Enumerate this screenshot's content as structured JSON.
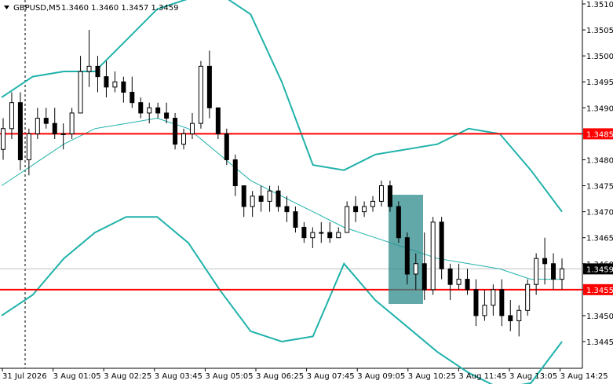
{
  "chart_data": {
    "type": "candlestick",
    "header": {
      "symbol_tf": "GBPUSD,M5",
      "ohlc": "1.3460 1.3460 1.3457 1.3459"
    },
    "y_range": [
      1.344,
      1.351
    ],
    "y_ticks": [
      "1.3510",
      "1.3505",
      "1.3500",
      "1.3495",
      "1.3490",
      "1.3485",
      "1.3480",
      "1.3475",
      "1.3470",
      "1.3465",
      "1.3460",
      "1.3455",
      "1.3450",
      "1.3445"
    ],
    "x_ticks": [
      "31 Jul 2026",
      "3 Aug 01:05",
      "3 Aug 02:25",
      "3 Aug 03:45",
      "3 Aug 05:05",
      "3 Aug 06:25",
      "3 Aug 07:45",
      "3 Aug 09:05",
      "3 Aug 10:25",
      "3 Aug 11:45",
      "3 Aug 13:05",
      "3 Aug 14:25"
    ],
    "grid": false,
    "levels": [
      {
        "value": 1.3485,
        "label": "1.3485",
        "color": "#ff0000"
      },
      {
        "value": 1.3455,
        "label": "1.3455",
        "color": "#ff0000"
      }
    ],
    "current_price": {
      "value": 1.3459,
      "label": "1.3459"
    },
    "colors": {
      "bands": "#20b2aa",
      "highlight_box": "#2e8b8b",
      "level_line": "#ff0000",
      "candle": "#000000"
    },
    "bollinger": {
      "upper": [
        1.3492,
        1.3496,
        1.3497,
        1.3497,
        1.3503,
        1.3509,
        1.3511,
        1.3512,
        1.3508,
        1.3495,
        1.3479,
        1.3478,
        1.3481,
        1.3482,
        1.3483,
        1.3486,
        1.3485,
        1.3478,
        1.347
      ],
      "middle": [
        1.3475,
        1.3479,
        1.3483,
        1.3486,
        1.3487,
        1.3488,
        1.3486,
        1.3481,
        1.3476,
        1.3473,
        1.347,
        1.3467,
        1.3465,
        1.3463,
        1.3461,
        1.346,
        1.3459,
        1.3457,
        1.3457
      ],
      "lower": [
        1.345,
        1.3454,
        1.3461,
        1.3466,
        1.3469,
        1.3469,
        1.3464,
        1.3455,
        1.3447,
        1.3445,
        1.3446,
        1.346,
        1.3453,
        1.3448,
        1.3443,
        1.3439,
        1.3436,
        1.3437,
        1.3445
      ]
    },
    "candles": [
      [
        1.3482,
        1.3488,
        1.348,
        1.3486
      ],
      [
        1.3486,
        1.3493,
        1.3484,
        1.3491
      ],
      [
        1.3491,
        1.3493,
        1.3478,
        1.348
      ],
      [
        1.348,
        1.3486,
        1.3477,
        1.3485
      ],
      [
        1.3485,
        1.349,
        1.3484,
        1.3488
      ],
      [
        1.3488,
        1.349,
        1.3486,
        1.3487
      ],
      [
        1.3487,
        1.349,
        1.3484,
        1.3485
      ],
      [
        1.3485,
        1.3487,
        1.3482,
        1.3485
      ],
      [
        1.3485,
        1.349,
        1.3484,
        1.3489
      ],
      [
        1.3489,
        1.35,
        1.3489,
        1.3497
      ],
      [
        1.3497,
        1.3505,
        1.3494,
        1.3498
      ],
      [
        1.3498,
        1.35,
        1.3493,
        1.3496
      ],
      [
        1.3496,
        1.3499,
        1.3492,
        1.3494
      ],
      [
        1.3494,
        1.3497,
        1.3493,
        1.3495
      ],
      [
        1.3495,
        1.3496,
        1.3491,
        1.3493
      ],
      [
        1.3493,
        1.3496,
        1.349,
        1.3491
      ],
      [
        1.3491,
        1.3492,
        1.3488,
        1.3489
      ],
      [
        1.3489,
        1.3491,
        1.3487,
        1.349
      ],
      [
        1.349,
        1.3491,
        1.3488,
        1.3489
      ],
      [
        1.3489,
        1.3491,
        1.3487,
        1.3488
      ],
      [
        1.3488,
        1.3489,
        1.3482,
        1.3483
      ],
      [
        1.3483,
        1.3486,
        1.3482,
        1.3485
      ],
      [
        1.3485,
        1.3489,
        1.3484,
        1.3487
      ],
      [
        1.3487,
        1.3499,
        1.3486,
        1.3498
      ],
      [
        1.3498,
        1.3501,
        1.3488,
        1.349
      ],
      [
        1.349,
        1.349,
        1.3484,
        1.3485
      ],
      [
        1.3485,
        1.3486,
        1.3479,
        1.348
      ],
      [
        1.348,
        1.3481,
        1.3473,
        1.3475
      ],
      [
        1.3475,
        1.3475,
        1.3469,
        1.3471
      ],
      [
        1.3471,
        1.3474,
        1.3469,
        1.3473
      ],
      [
        1.3473,
        1.3475,
        1.347,
        1.3472
      ],
      [
        1.3472,
        1.3475,
        1.347,
        1.3474
      ],
      [
        1.3474,
        1.3475,
        1.347,
        1.3471
      ],
      [
        1.3471,
        1.3473,
        1.3468,
        1.347
      ],
      [
        1.347,
        1.3471,
        1.3466,
        1.3467
      ],
      [
        1.3467,
        1.3468,
        1.3464,
        1.3465
      ],
      [
        1.3465,
        1.3467,
        1.3463,
        1.3466
      ],
      [
        1.3466,
        1.3468,
        1.3464,
        1.3466
      ],
      [
        1.3466,
        1.3468,
        1.3464,
        1.3465
      ],
      [
        1.3465,
        1.3467,
        1.3465,
        1.3466
      ],
      [
        1.3466,
        1.3472,
        1.3466,
        1.3471
      ],
      [
        1.3471,
        1.3473,
        1.3468,
        1.347
      ],
      [
        1.347,
        1.3472,
        1.3469,
        1.3471
      ],
      [
        1.3471,
        1.3473,
        1.347,
        1.3472
      ],
      [
        1.3472,
        1.3476,
        1.3471,
        1.3475
      ],
      [
        1.3475,
        1.3476,
        1.347,
        1.3471
      ],
      [
        1.3471,
        1.3472,
        1.3464,
        1.3465
      ],
      [
        1.3465,
        1.3466,
        1.3456,
        1.3458
      ],
      [
        1.3458,
        1.3462,
        1.3455,
        1.346
      ],
      [
        1.346,
        1.3466,
        1.3453,
        1.3455
      ],
      [
        1.3455,
        1.3469,
        1.3454,
        1.3468
      ],
      [
        1.3468,
        1.3469,
        1.3457,
        1.3459
      ],
      [
        1.3459,
        1.346,
        1.3453,
        1.3456
      ],
      [
        1.3456,
        1.346,
        1.3455,
        1.3457
      ],
      [
        1.3457,
        1.3459,
        1.3454,
        1.3455
      ],
      [
        1.3455,
        1.3457,
        1.3448,
        1.345
      ],
      [
        1.345,
        1.3455,
        1.3449,
        1.3452
      ],
      [
        1.3452,
        1.3456,
        1.345,
        1.3455
      ],
      [
        1.3455,
        1.3457,
        1.3448,
        1.345
      ],
      [
        1.345,
        1.3453,
        1.3447,
        1.3449
      ],
      [
        1.3449,
        1.3452,
        1.3446,
        1.3451
      ],
      [
        1.3451,
        1.3457,
        1.345,
        1.3456
      ],
      [
        1.3456,
        1.3462,
        1.3454,
        1.3461
      ],
      [
        1.3461,
        1.3465,
        1.3456,
        1.346
      ],
      [
        1.346,
        1.3462,
        1.3455,
        1.3457
      ],
      [
        1.3457,
        1.3461,
        1.3455,
        1.3459
      ]
    ]
  }
}
